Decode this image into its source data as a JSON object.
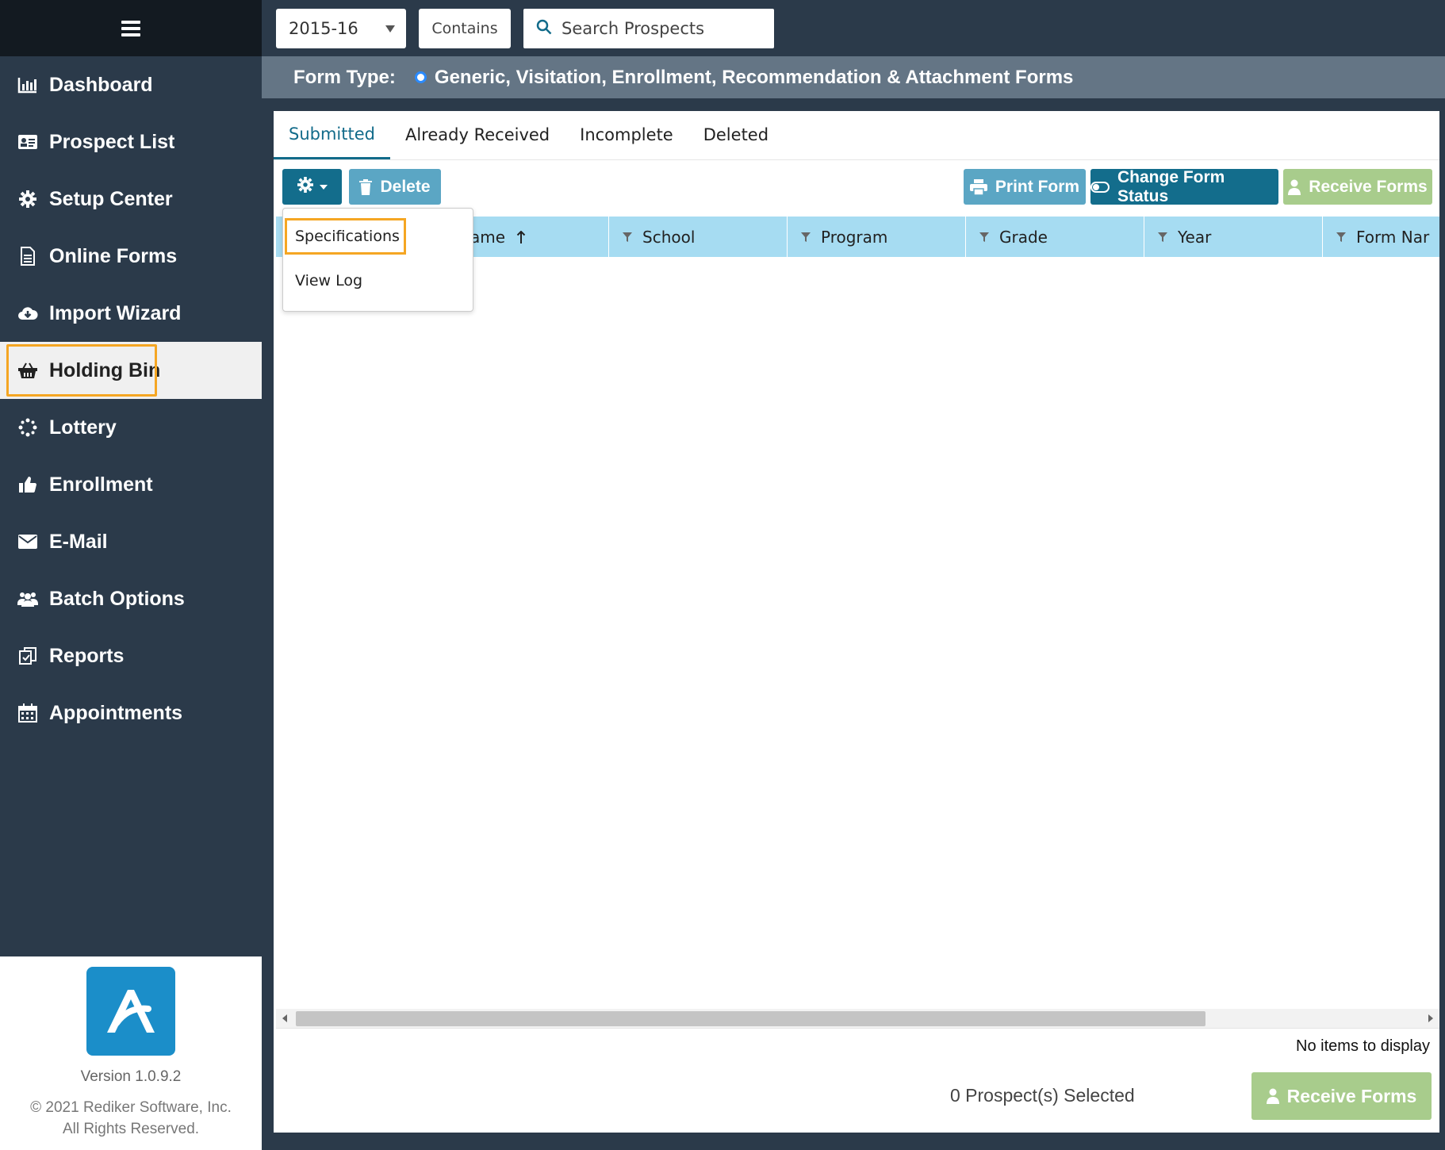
{
  "topbar": {
    "year": "2015-16",
    "match_mode": "Contains",
    "search_placeholder": "Search Prospects"
  },
  "form_type": {
    "label": "Form Type:",
    "option": "Generic, Visitation, Enrollment, Recommendation & Attachment Forms"
  },
  "sidebar": {
    "items": [
      {
        "label": "Dashboard",
        "icon": "bar-chart-icon"
      },
      {
        "label": "Prospect List",
        "icon": "id-card-icon"
      },
      {
        "label": "Setup Center",
        "icon": "gear-icon"
      },
      {
        "label": "Online Forms",
        "icon": "document-icon"
      },
      {
        "label": "Import Wizard",
        "icon": "cloud-download-icon"
      },
      {
        "label": "Holding Bin",
        "icon": "basket-icon",
        "active": true
      },
      {
        "label": "Lottery",
        "icon": "spinner-icon"
      },
      {
        "label": "Enrollment",
        "icon": "thumbs-up-icon"
      },
      {
        "label": "E-Mail",
        "icon": "envelope-icon"
      },
      {
        "label": "Batch Options",
        "icon": "users-icon"
      },
      {
        "label": "Reports",
        "icon": "copy-icon"
      },
      {
        "label": "Appointments",
        "icon": "calendar-icon"
      }
    ],
    "version": "Version 1.0.9.2",
    "copyright_line1": "© 2021 Rediker Software, Inc.",
    "copyright_line2": "All Rights Reserved."
  },
  "tabs": [
    "Submitted",
    "Already Received",
    "Incomplete",
    "Deleted"
  ],
  "toolbar": {
    "delete": "Delete",
    "print": "Print Form",
    "change_status": "Change Form Status",
    "receive": "Receive Forms"
  },
  "dropdown": {
    "items": [
      "Specifications",
      "View Log"
    ]
  },
  "grid": {
    "columns": [
      "ame",
      "School",
      "Program",
      "Grade",
      "Year",
      "Form Nar"
    ]
  },
  "footer": {
    "no_items": "No items to display",
    "selected": "0 Prospect(s) Selected",
    "receive": "Receive Forms"
  },
  "colors": {
    "sidebar_bg": "#2b3a4a",
    "accent": "#136d8c",
    "highlight": "#f5a623",
    "grid_header": "#a6dcf2",
    "receive_green": "#a8cc8c"
  }
}
